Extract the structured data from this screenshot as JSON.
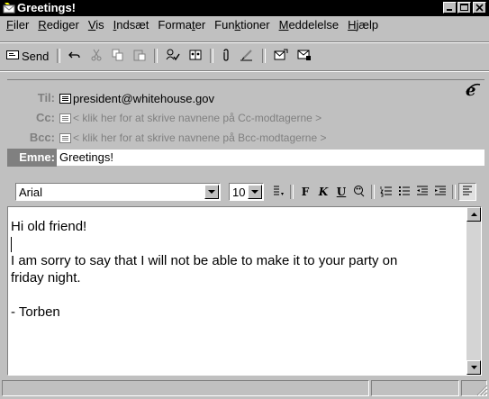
{
  "window": {
    "title": "Greetings!",
    "icon": "envelope-icon"
  },
  "menu": {
    "items": [
      {
        "label": "Filer",
        "u": "F"
      },
      {
        "label": "Rediger",
        "u": "R"
      },
      {
        "label": "Vis",
        "u": "V"
      },
      {
        "label": "Indsæt",
        "u": "I"
      },
      {
        "label": "Formater",
        "u": "t"
      },
      {
        "label": "Funktioner",
        "u": "k"
      },
      {
        "label": "Meddelelse",
        "u": "M"
      },
      {
        "label": "Hjælp",
        "u": "H"
      }
    ]
  },
  "toolbar": {
    "send_label": "Send",
    "icons": [
      "send-icon",
      "undo-icon",
      "cut-icon",
      "copy-icon",
      "paste-icon",
      "check-names-icon",
      "address-book-icon",
      "attach-icon",
      "signature-icon",
      "insert-file-icon",
      "encrypt-icon"
    ]
  },
  "headers": {
    "to_label": "Til:",
    "to_value": "president@whitehouse.gov",
    "cc_label": "Cc:",
    "cc_hint": "< klik her for at skrive navnene på Cc-modtagerne >",
    "bcc_label": "Bcc:",
    "bcc_hint": "< klik her for at skrive navnene på Bcc-modtagerne >",
    "subject_label": "Emne:",
    "subject_value": "Greetings!"
  },
  "format": {
    "font": "Arial",
    "size": "10",
    "bold": "F",
    "italic": "K",
    "underline": "U"
  },
  "message": {
    "lines": [
      "Hi old friend!",
      "",
      "I am sorry to say that I will not be able to make it to your party on",
      "friday night.",
      "",
      "- Torben"
    ]
  }
}
